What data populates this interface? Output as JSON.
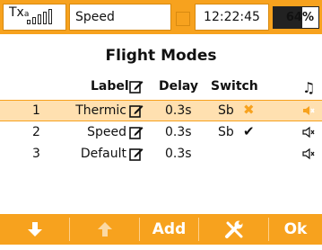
{
  "status": {
    "tx_label": "Tx",
    "tx_sub": "a",
    "mode": "Speed",
    "time": "12:22:45",
    "battery_text": "64%",
    "battery_level": 0.64
  },
  "title": "Flight Modes",
  "columns": {
    "label": "Label",
    "delay": "Delay",
    "switch": "Switch"
  },
  "rows": [
    {
      "num": "1",
      "label": "Thermic",
      "delay": "0.3s",
      "switch": "Sb",
      "switch_state": "off",
      "selected": true
    },
    {
      "num": "2",
      "label": "Speed",
      "delay": "0.3s",
      "switch": "Sb",
      "switch_state": "on",
      "selected": false
    },
    {
      "num": "3",
      "label": "Default",
      "delay": "0.3s",
      "switch": "",
      "switch_state": "none",
      "selected": false
    }
  ],
  "footer": {
    "add_label": "Add",
    "ok_label": "Ok"
  },
  "colors": {
    "accent": "#f7a21e",
    "selected_row": "#ffe0b0"
  }
}
